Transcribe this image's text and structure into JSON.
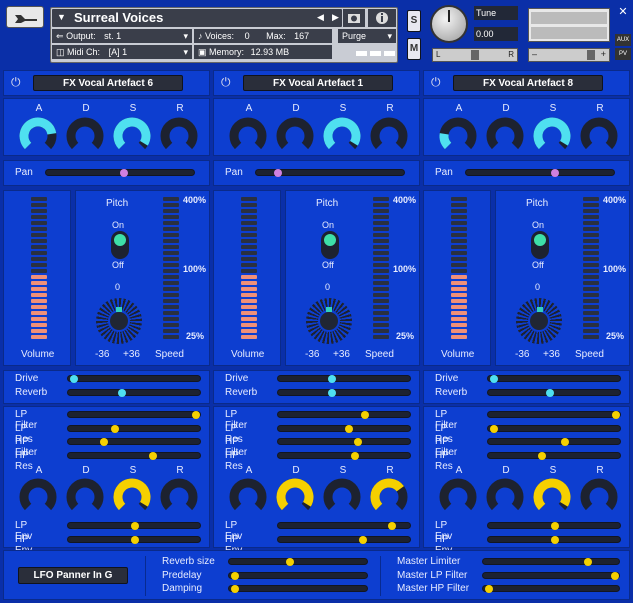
{
  "header": {
    "title": "Surreal Voices",
    "output_label": "Output:",
    "output_value": "st. 1",
    "midi_label": "Midi Ch:",
    "midi_value": "[A]  1",
    "voices_label": "Voices:",
    "voices_value": "0",
    "max_label": "Max:",
    "max_value": "167",
    "memory_label": "Memory:",
    "memory_value": "12.93 MB",
    "purge_label": "Purge",
    "s_label": "S",
    "m_label": "M",
    "tune_label": "Tune",
    "tune_value": "0.00",
    "pan_l": "L",
    "pan_r": "R",
    "aux_label": "AUX",
    "pv_label": "PV",
    "vol_minus": "–",
    "vol_plus": "+"
  },
  "modules": [
    {
      "title": "FX Vocal Artefact 6",
      "pan": 0.52,
      "pitch": "0",
      "drive": 0.02,
      "reverb": 0.4,
      "lp_filter": 0.98,
      "lp_res": 0.34,
      "hp_filter": 0.26,
      "hp_res": 0.64,
      "lp_env": 0.5,
      "hp_env": 0.5,
      "adsr": [
        0.8,
        0.0,
        0.95,
        0.0
      ],
      "fadsr": [
        0.0,
        0.0,
        0.95,
        0.0
      ],
      "pitch_knob": 0.5
    },
    {
      "title": "FX Vocal Artefact 1",
      "pan": 0.13,
      "pitch": "0",
      "drive": 0.4,
      "reverb": 0.4,
      "lp_filter": 0.66,
      "lp_res": 0.53,
      "hp_filter": 0.6,
      "hp_res": 0.58,
      "lp_env": 0.87,
      "hp_env": 0.64,
      "adsr": [
        0.0,
        0.0,
        0.95,
        0.0
      ],
      "fadsr": [
        0.0,
        0.95,
        0.0,
        0.7
      ],
      "pitch_knob": 0.5
    },
    {
      "title": "FX Vocal Artefact 8",
      "pan": 0.6,
      "pitch": "0",
      "drive": 0.02,
      "reverb": 0.46,
      "lp_filter": 0.98,
      "lp_res": 0.02,
      "hp_filter": 0.58,
      "hp_res": 0.4,
      "lp_env": 0.5,
      "hp_env": 0.5,
      "adsr": [
        0.2,
        0.0,
        0.95,
        0.0
      ],
      "fadsr": [
        0.0,
        0.0,
        0.95,
        0.0
      ],
      "pitch_knob": 0.6
    }
  ],
  "labels": {
    "a": "A",
    "d": "D",
    "s": "S",
    "r": "R",
    "pan": "Pan",
    "pitch": "Pitch",
    "on": "On",
    "off": "Off",
    "volume": "Volume",
    "speed": "Speed",
    "minus36": "-36",
    "plus36": "+36",
    "p400": "400%",
    "p100": "100%",
    "p25": "25%",
    "drive": "Drive",
    "reverb": "Reverb",
    "lp_filter": "LP Filter",
    "lp_res": "LP Res",
    "hp_filter": "HP Filter",
    "hp_res": "HP Res",
    "lp_env": "LP Env",
    "hp_env": "HP Env"
  },
  "footer": {
    "lfo_button": "LFO Panner In G",
    "reverb_size": "Reverb size",
    "predelay": "Predelay",
    "damping": "Damping",
    "master_limiter": "Master Limiter",
    "master_lp": "Master LP Filter",
    "master_hp": "Master HP Filter",
    "values": {
      "reverb_size": 0.43,
      "predelay": 0.02,
      "damping": 0.02,
      "master_limiter": 0.77,
      "master_lp": 0.98,
      "master_hp": 0.02
    }
  },
  "colors": {
    "cyan": "#4fe0f0",
    "yellow": "#f5d000",
    "pink": "#d080e0",
    "teal": "#30d0c0",
    "meter_on": "#f09078",
    "meter_off": "#2a3040"
  }
}
